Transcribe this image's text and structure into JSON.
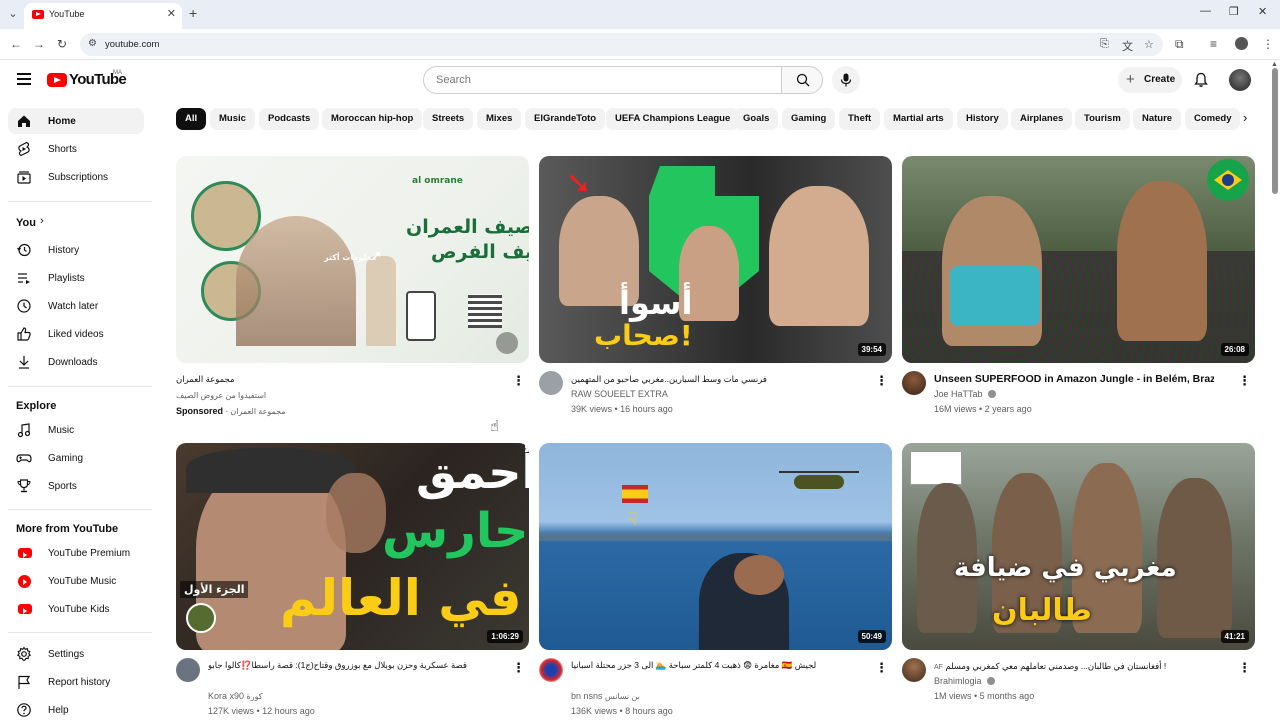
{
  "browser": {
    "tab_title": "YouTube",
    "url": "youtube.com"
  },
  "masthead": {
    "logo_text": "YouTube",
    "logo_country": "MA",
    "search_placeholder": "Search",
    "create_label": "Create"
  },
  "sidebar": {
    "main": [
      {
        "label": "Home",
        "icon": "home-icon"
      },
      {
        "label": "Shorts",
        "icon": "shorts-icon"
      },
      {
        "label": "Subscriptions",
        "icon": "subscriptions-icon"
      }
    ],
    "you_heading": "You",
    "you_items": [
      {
        "label": "History",
        "icon": "history-icon"
      },
      {
        "label": "Playlists",
        "icon": "playlists-icon"
      },
      {
        "label": "Watch later",
        "icon": "watch-later-icon"
      },
      {
        "label": "Liked videos",
        "icon": "like-icon"
      },
      {
        "label": "Downloads",
        "icon": "download-icon"
      }
    ],
    "explore_heading": "Explore",
    "explore_items": [
      {
        "label": "Music",
        "icon": "music-icon"
      },
      {
        "label": "Gaming",
        "icon": "gaming-icon"
      },
      {
        "label": "Sports",
        "icon": "trophy-icon"
      }
    ],
    "more_heading": "More from YouTube",
    "more_items": [
      {
        "label": "YouTube Premium",
        "icon": "youtube-premium-icon"
      },
      {
        "label": "YouTube Music",
        "icon": "youtube-music-icon"
      },
      {
        "label": "YouTube Kids",
        "icon": "youtube-kids-icon"
      }
    ],
    "settings_items": [
      {
        "label": "Settings",
        "icon": "gear-icon"
      },
      {
        "label": "Report history",
        "icon": "flag-icon"
      },
      {
        "label": "Help",
        "icon": "help-icon"
      }
    ]
  },
  "chips": [
    "All",
    "Music",
    "Podcasts",
    "Moroccan hip-hop",
    "Streets",
    "Mixes",
    "ElGrandeToto",
    "UEFA Champions League",
    "Goals",
    "Gaming",
    "Theft",
    "Martial arts",
    "History",
    "Airplanes",
    "Tourism",
    "Nature",
    "Comedy"
  ],
  "videos": [
    {
      "title": "مجموعة العمران",
      "channel": "استفيدوا من عروض الصيف",
      "meta": "Sponsored",
      "meta_suffix": "· مجموعة العمران",
      "duration": "",
      "thumb_caption": "معلومات أكثر",
      "thumb_headline": "صيف العمران...",
      "thumb_sub": "صيف الفرص",
      "thumb_brand": "al omrane"
    },
    {
      "title": "فرنسي مات وسط السبارين..مغربي صاحبو من المتهمين",
      "channel": "RAW SOUEELT EXTRA",
      "meta": "39K views • 16 hours ago",
      "duration": "39:54",
      "thumb_text_1": "أسوأ",
      "thumb_text_2": "صحاب!"
    },
    {
      "title": "Unseen SUPERFOOD in Amazon Jungle - in Belém, Brazil",
      "title_badge": "BR",
      "channel": "Joe HaTTab",
      "meta": "16M views • 2 years ago",
      "duration": "26:08"
    },
    {
      "title": "قصة عسكرية وحزن بوبلال مع بوزروق وقتاح(ج1): قصة راسطا⁉️كالوا جابو",
      "channel": "Kora x90",
      "channel_suffix": "كورة",
      "meta": "127K views • 12 hours ago",
      "duration": "1:06:29",
      "thumb_text_1": "أحمق",
      "thumb_text_2": "حارس",
      "thumb_text_3": "في العالم",
      "thumb_tag": "الجزء الأول"
    },
    {
      "title": "مغامرة 😨 ذهبت 4 كلمتر سباحة 🏊 الى 3 جزر محتلة اسبانيا 🇪🇸 لجيش",
      "channel": "bn nsns",
      "channel_suffix": "بن نسانس",
      "meta": "136K views • 8 hours ago",
      "duration": "50:49"
    },
    {
      "title": "أفغانستان في طالبان... وصدمني تعاملهم معي كمغربي ومسلم !",
      "title_prefix": "AF",
      "channel": "Brahimlogia",
      "meta": "1M views • 5 months ago",
      "duration": "41:21",
      "thumb_text_1": "مغربي في ضيافة",
      "thumb_text_2": "طالبان"
    }
  ],
  "colors": {
    "brand_red": "#ff0000",
    "text_primary": "#0f0f0f",
    "text_secondary": "#606060",
    "chip_bg": "#f2f2f2"
  }
}
